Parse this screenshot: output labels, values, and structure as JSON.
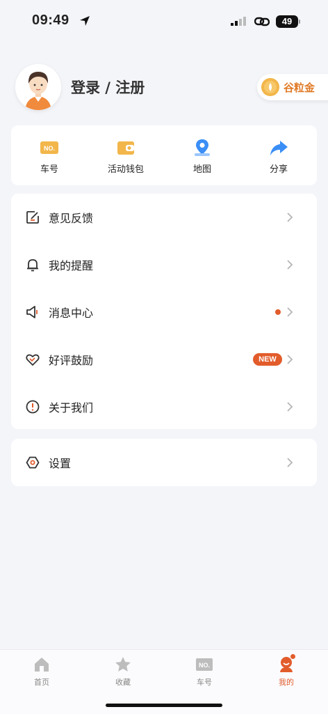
{
  "status": {
    "time": "09:49",
    "battery": "49"
  },
  "profile": {
    "login_label": "登录 / 注册",
    "grain_label": "谷粒金"
  },
  "quick_actions": [
    {
      "label": "车号",
      "icon": "plate-icon"
    },
    {
      "label": "活动钱包",
      "icon": "wallet-icon"
    },
    {
      "label": "地图",
      "icon": "map-pin-icon"
    },
    {
      "label": "分享",
      "icon": "share-icon"
    }
  ],
  "menu": [
    {
      "label": "意见反馈",
      "icon": "edit-icon"
    },
    {
      "label": "我的提醒",
      "icon": "bell-icon"
    },
    {
      "label": "消息中心",
      "icon": "speaker-icon",
      "dot": true
    },
    {
      "label": "好评鼓励",
      "icon": "heart-icon",
      "badge": "NEW"
    },
    {
      "label": "关于我们",
      "icon": "info-icon"
    }
  ],
  "settings": {
    "label": "设置",
    "icon": "settings-icon"
  },
  "tabs": [
    {
      "label": "首页",
      "icon": "home-icon"
    },
    {
      "label": "收藏",
      "icon": "star-icon"
    },
    {
      "label": "车号",
      "icon": "plate-icon"
    },
    {
      "label": "我的",
      "icon": "profile-icon",
      "active": true
    }
  ],
  "colors": {
    "accent": "#e25c2b",
    "orange": "#f2b64a",
    "blue": "#3a8ef6"
  }
}
